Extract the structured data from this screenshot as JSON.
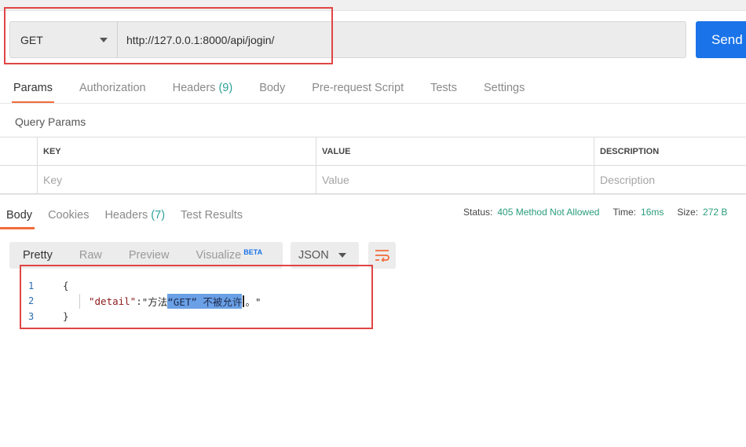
{
  "request": {
    "method": "GET",
    "url": "http://127.0.0.1:8000/api/jogin/",
    "send_label": "Send"
  },
  "request_tabs": [
    {
      "label": "Params",
      "count": ""
    },
    {
      "label": "Authorization",
      "count": ""
    },
    {
      "label": "Headers",
      "count": "(9)"
    },
    {
      "label": "Body",
      "count": ""
    },
    {
      "label": "Pre-request Script",
      "count": ""
    },
    {
      "label": "Tests",
      "count": ""
    },
    {
      "label": "Settings",
      "count": ""
    }
  ],
  "query_params": {
    "title": "Query Params",
    "headers": [
      "KEY",
      "VALUE",
      "DESCRIPTION"
    ],
    "placeholders": [
      "Key",
      "Value",
      "Description"
    ]
  },
  "response_tabs": [
    {
      "label": "Body",
      "count": ""
    },
    {
      "label": "Cookies",
      "count": ""
    },
    {
      "label": "Headers",
      "count": "(7)"
    },
    {
      "label": "Test Results",
      "count": ""
    }
  ],
  "status": {
    "status_label": "Status:",
    "status_value": "405 Method Not Allowed",
    "time_label": "Time:",
    "time_value": "16ms",
    "size_label": "Size:",
    "size_value": "272 B"
  },
  "view_options": {
    "pretty": "Pretty",
    "raw": "Raw",
    "preview": "Preview",
    "visualize": "Visualize",
    "beta": "BETA",
    "format": "JSON"
  },
  "response_body": {
    "line_numbers": [
      "1",
      "2",
      "3"
    ],
    "open_brace": "{",
    "key": "\"detail\"",
    "colon": ": ",
    "value_prefix": "\"方法",
    "value_selected": "“GET” 不被允许",
    "value_suffix": "。\"",
    "close_brace": "}"
  },
  "colors": {
    "send_button": "#1a73e8",
    "active_tab_underline": "#f26b3a",
    "status_value": "#2a9d7a",
    "annotation_box": "#e04545"
  }
}
